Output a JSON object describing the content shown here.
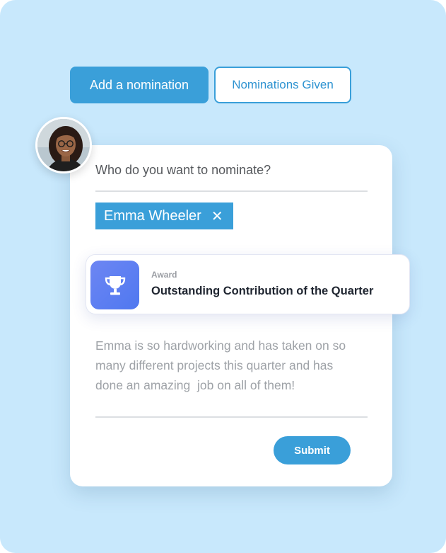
{
  "tabs": {
    "add_label": "Add a nomination",
    "given_label": "Nominations Given"
  },
  "form": {
    "question": "Who do you want to nominate?",
    "nominee_chip": {
      "name": "Emma Wheeler",
      "remove_icon": "close-icon",
      "remove_glyph": "✕"
    },
    "award": {
      "label": "Award",
      "title": "Outstanding Contribution of the Quarter",
      "icon": "trophy-icon"
    },
    "message": "Emma is so hardworking and has taken on so many different projects this quarter and has done an amazing  job on all of them!",
    "submit_label": "Submit"
  },
  "colors": {
    "background": "#c8e8fc",
    "accent": "#3a9fd9",
    "award_icon_bg": "#5b7ff2"
  }
}
